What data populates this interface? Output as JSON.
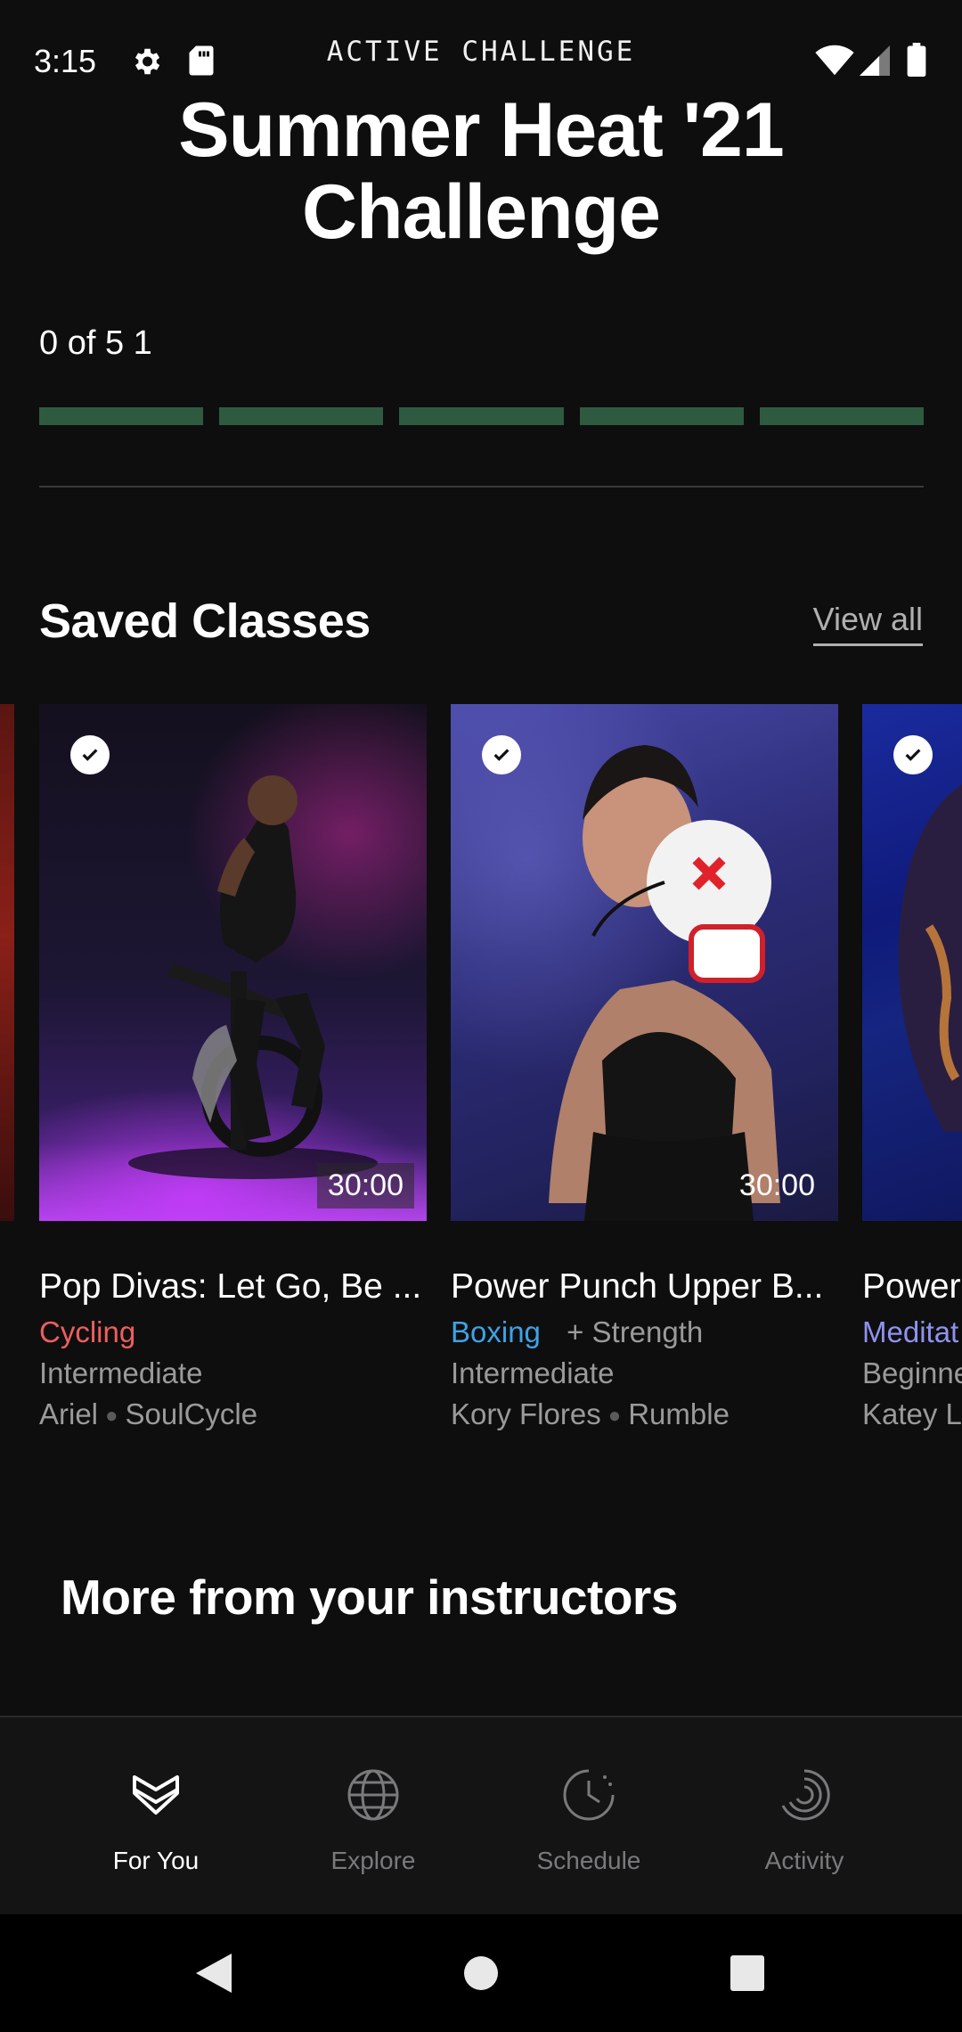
{
  "status_bar": {
    "time": "3:15",
    "label": "ACTIVE CHALLENGE",
    "icons": [
      "gear-icon",
      "sd-card-icon",
      "wifi-icon",
      "signal-icon",
      "battery-icon"
    ]
  },
  "challenge": {
    "title": "Summer Heat '21 Challenge",
    "progress_text": "0 of 5  1",
    "completed": 0,
    "total": 5,
    "segment_color": "#2e5a40"
  },
  "saved_classes": {
    "heading": "Saved Classes",
    "view_all": "View all",
    "cards": [
      {
        "title": "Pop Divas: Let Go, Be ...",
        "category": "Cycling",
        "category_color": "#ee5e5e",
        "extra": "",
        "level": "Intermediate",
        "instructor": "Ariel",
        "studio": "SoulCycle",
        "duration": "30:00"
      },
      {
        "title": "Power Punch Upper B...",
        "category": "Boxing",
        "category_color": "#3da3e6",
        "extra": "+ Strength",
        "level": "Intermediate",
        "instructor": "Kory Flores",
        "studio": "Rumble",
        "duration": "30:00"
      },
      {
        "title": "Power",
        "category": "Meditat",
        "category_color": "#8e93ee",
        "level": "Beginne",
        "instructor": "Katey L"
      }
    ]
  },
  "more_section": {
    "heading": "More from your instructors"
  },
  "bottom_nav": {
    "items": [
      {
        "label": "For You",
        "icon": "for-you-icon",
        "active": true
      },
      {
        "label": "Explore",
        "icon": "globe-icon",
        "active": false
      },
      {
        "label": "Schedule",
        "icon": "clock-icon",
        "active": false
      },
      {
        "label": "Activity",
        "icon": "activity-rings-icon",
        "active": false
      }
    ]
  },
  "colors": {
    "background": "#0e0e0f",
    "nav_background": "#141415",
    "inactive_nav": "#7a7a7c"
  }
}
